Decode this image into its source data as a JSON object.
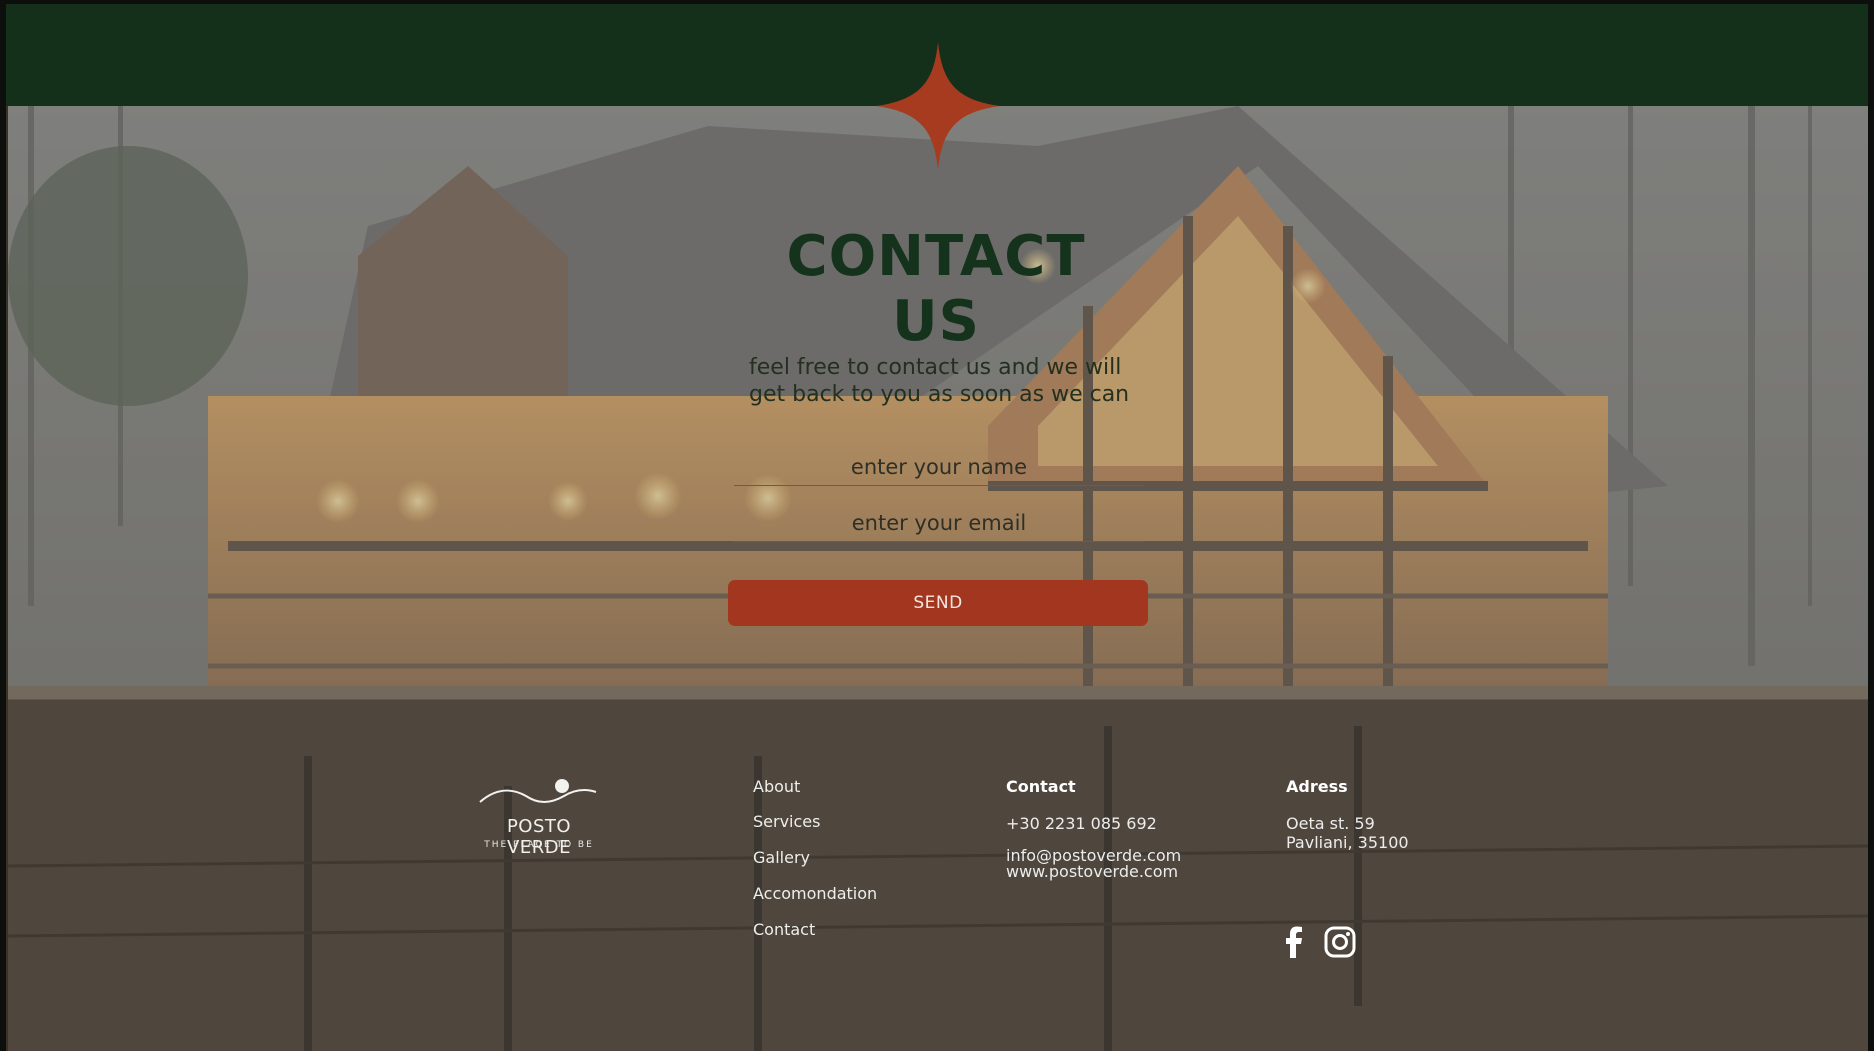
{
  "contact": {
    "title": "CONTACT US",
    "subtitle_line1": "feel free to contact us and we will",
    "subtitle_line2": "get back to you as soon as we can",
    "name_placeholder": "enter your name",
    "email_placeholder": "enter your email",
    "send_label": "SEND"
  },
  "brand": {
    "name": "POSTO VERDE",
    "tagline": "THE PLACE TO BE"
  },
  "nav": [
    {
      "label": "About"
    },
    {
      "label": "Services"
    },
    {
      "label": "Gallery"
    },
    {
      "label": "Accomondation"
    },
    {
      "label": "Contact"
    }
  ],
  "contact_info": {
    "heading": "Contact",
    "phone": "+30 2231 085 692",
    "email": "info@postoverde.com",
    "website": "www.postoverde.com"
  },
  "address": {
    "heading": "Adress",
    "line1": "Oeta st. 59",
    "line2": "Pavliani, 35100"
  },
  "social": {
    "icons": [
      "facebook-icon",
      "instagram-icon"
    ]
  },
  "colors": {
    "top_band": "#14301a",
    "accent": "#a3361f",
    "title": "#15331c"
  }
}
